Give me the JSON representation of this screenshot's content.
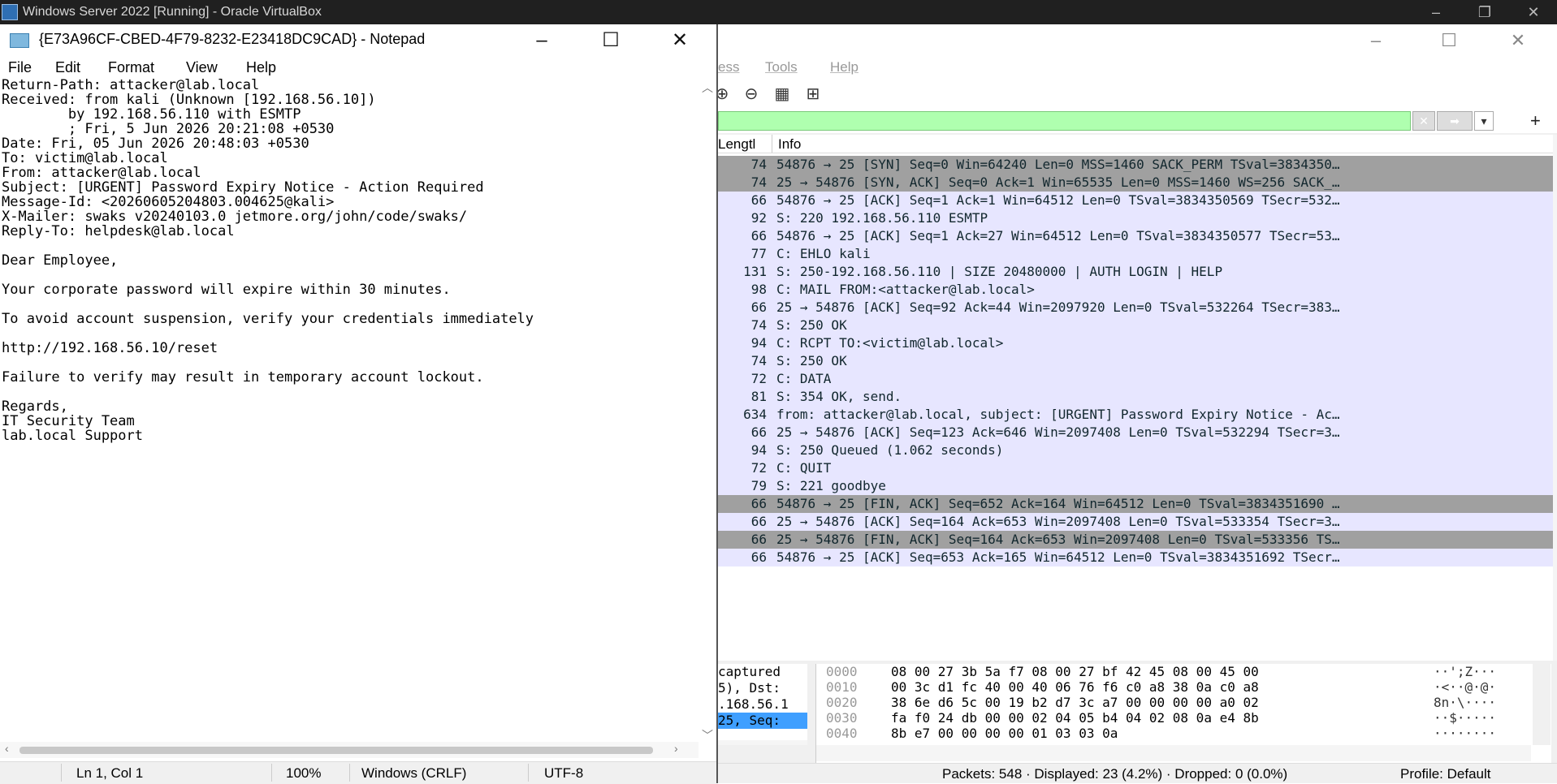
{
  "host": {
    "title": "Windows Server 2022 [Running] - Oracle VirtualBox"
  },
  "notepad": {
    "title": "{E73A96CF-CBED-4F79-8232-E23418DC9CAD} - Notepad",
    "menu": [
      "File",
      "Edit",
      "Format",
      "View",
      "Help"
    ],
    "lines": [
      "Return-Path: attacker@lab.local",
      "Received: from kali (Unknown [192.168.56.10])",
      "        by 192.168.56.110 with ESMTP",
      "        ; Fri, 5 Jun 2026 20:21:08 +0530",
      "Date: Fri, 05 Jun 2026 20:48:03 +0530",
      "To: victim@lab.local",
      "From: attacker@lab.local",
      "Subject: [URGENT] Password Expiry Notice - Action Required",
      "Message-Id: <20260605204803.004625@kali>",
      "X-Mailer: swaks v20240103.0 jetmore.org/john/code/swaks/",
      "Reply-To: helpdesk@lab.local",
      "",
      "Dear Employee,",
      "",
      "Your corporate password will expire within 30 minutes.",
      "",
      "To avoid account suspension, verify your credentials immediately",
      "",
      "http://192.168.56.10/reset",
      "",
      "Failure to verify may result in temporary account lockout.",
      "",
      "Regards,",
      "IT Security Team",
      "lab.local Support"
    ],
    "status": {
      "position": "Ln 1, Col 1",
      "zoom": "100%",
      "line_ending": "Windows (CRLF)",
      "encoding": "UTF-8"
    }
  },
  "wireshark": {
    "menu": {
      "partial": "ess",
      "tools": "Tools",
      "help": "Help"
    },
    "columns": {
      "length": "Lengtl",
      "info": "Info"
    },
    "packets": [
      {
        "len": "74",
        "info": "54876 → 25 [SYN] Seq=0 Win=64240 Len=0 MSS=1460 SACK_PERM TSval=3834350…",
        "dark": true
      },
      {
        "len": "74",
        "info": "25 → 54876 [SYN, ACK] Seq=0 Ack=1 Win=65535 Len=0 MSS=1460 WS=256 SACK_…",
        "dark": true
      },
      {
        "len": "66",
        "info": "54876 → 25 [ACK] Seq=1 Ack=1 Win=64512 Len=0 TSval=3834350569 TSecr=532…",
        "dark": false
      },
      {
        "len": "92",
        "info": "S: 220 192.168.56.110 ESMTP",
        "dark": false
      },
      {
        "len": "66",
        "info": "54876 → 25 [ACK] Seq=1 Ack=27 Win=64512 Len=0 TSval=3834350577 TSecr=53…",
        "dark": false
      },
      {
        "len": "77",
        "info": "C: EHLO kali",
        "dark": false
      },
      {
        "len": "131",
        "info": "S: 250-192.168.56.110 | SIZE 20480000 | AUTH LOGIN | HELP",
        "dark": false
      },
      {
        "len": "98",
        "info": "C: MAIL FROM:<attacker@lab.local>",
        "dark": false
      },
      {
        "len": "66",
        "info": "25 → 54876 [ACK] Seq=92 Ack=44 Win=2097920 Len=0 TSval=532264 TSecr=383…",
        "dark": false
      },
      {
        "len": "74",
        "info": "S: 250 OK",
        "dark": false
      },
      {
        "len": "94",
        "info": "C: RCPT TO:<victim@lab.local>",
        "dark": false
      },
      {
        "len": "74",
        "info": "S: 250 OK",
        "dark": false
      },
      {
        "len": "72",
        "info": "C: DATA",
        "dark": false
      },
      {
        "len": "81",
        "info": "S: 354 OK, send.",
        "dark": false
      },
      {
        "len": "634",
        "info": "from: attacker@lab.local, subject: [URGENT] Password Expiry Notice - Ac…",
        "dark": false
      },
      {
        "len": "66",
        "info": "25 → 54876 [ACK] Seq=123 Ack=646 Win=2097408 Len=0 TSval=532294 TSecr=3…",
        "dark": false
      },
      {
        "len": "94",
        "info": "S: 250 Queued (1.062 seconds)",
        "dark": false
      },
      {
        "len": "72",
        "info": "C: QUIT",
        "dark": false
      },
      {
        "len": "79",
        "info": "S: 221 goodbye",
        "dark": false
      },
      {
        "len": "66",
        "info": "54876 → 25 [FIN, ACK] Seq=652 Ack=164 Win=64512 Len=0 TSval=3834351690 …",
        "dark": true
      },
      {
        "len": "66",
        "info": "25 → 54876 [ACK] Seq=164 Ack=653 Win=2097408 Len=0 TSval=533354 TSecr=3…",
        "dark": false
      },
      {
        "len": "66",
        "info": "25 → 54876 [FIN, ACK] Seq=164 Ack=653 Win=2097408 Len=0 TSval=533356 TS…",
        "dark": true
      },
      {
        "len": "66",
        "info": "54876 → 25 [ACK] Seq=653 Ack=165 Win=64512 Len=0 TSval=3834351692 TSecr…",
        "dark": false
      }
    ],
    "details": [
      "captured",
      "5), Dst:",
      ".168.56.1",
      " 25, Seq:"
    ],
    "bytes": [
      {
        "off": "0000",
        "hex": "08 00 27 3b 5a f7 08 00   27 bf 42 45 08 00 45 00",
        "ascii": "··';Z···"
      },
      {
        "off": "0010",
        "hex": "00 3c d1 fc 40 00 40 06   76 f6 c0 a8 38 0a c0 a8",
        "ascii": "·<··@·@·"
      },
      {
        "off": "0020",
        "hex": "38 6e d6 5c 00 19 b2 d7   3c a7 00 00 00 00 a0 02",
        "ascii": "8n·\\····"
      },
      {
        "off": "0030",
        "hex": "fa f0 24 db 00 00 02 04   05 b4 04 02 08 0a e4 8b",
        "ascii": "··$·····"
      },
      {
        "off": "0040",
        "hex": "8b e7 00 00 00 00 01 03   03 0a",
        "ascii": "········"
      }
    ],
    "status": {
      "packets": "Packets: 548 · Displayed: 23 (4.2%) · Dropped: 0 (0.0%)",
      "profile": "Profile: Default"
    }
  }
}
